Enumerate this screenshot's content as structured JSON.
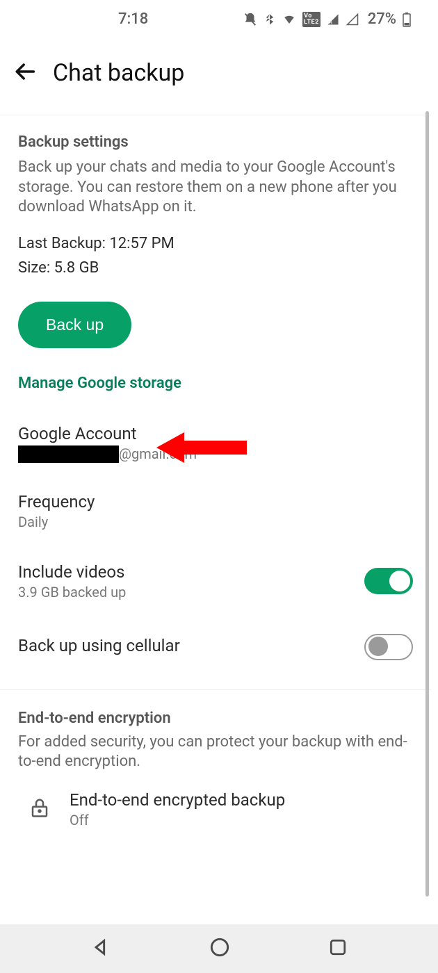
{
  "status": {
    "time": "7:18",
    "battery": "27%"
  },
  "header": {
    "title": "Chat backup"
  },
  "backup_settings": {
    "title": "Backup settings",
    "description": "Back up your chats and media to your Google Account's storage. You can restore them on a new phone after you download WhatsApp on it.",
    "last_backup_label": "Last Backup: ",
    "last_backup_value": "12:57 PM",
    "size_label": "Size: ",
    "size_value": "5.8 GB",
    "backup_button": "Back up",
    "manage_link": "Manage Google storage"
  },
  "settings": {
    "google_account": {
      "label": "Google Account",
      "value_suffix": "@gmail.com"
    },
    "frequency": {
      "label": "Frequency",
      "value": "Daily"
    },
    "include_videos": {
      "label": "Include videos",
      "value": "3.9 GB backed up",
      "enabled": true
    },
    "cellular": {
      "label": "Back up using cellular",
      "enabled": false
    }
  },
  "encryption": {
    "title": "End-to-end encryption",
    "description": "For added security, you can protect your backup with end-to-end encryption.",
    "item_label": "End-to-end encrypted backup",
    "item_value": "Off"
  }
}
